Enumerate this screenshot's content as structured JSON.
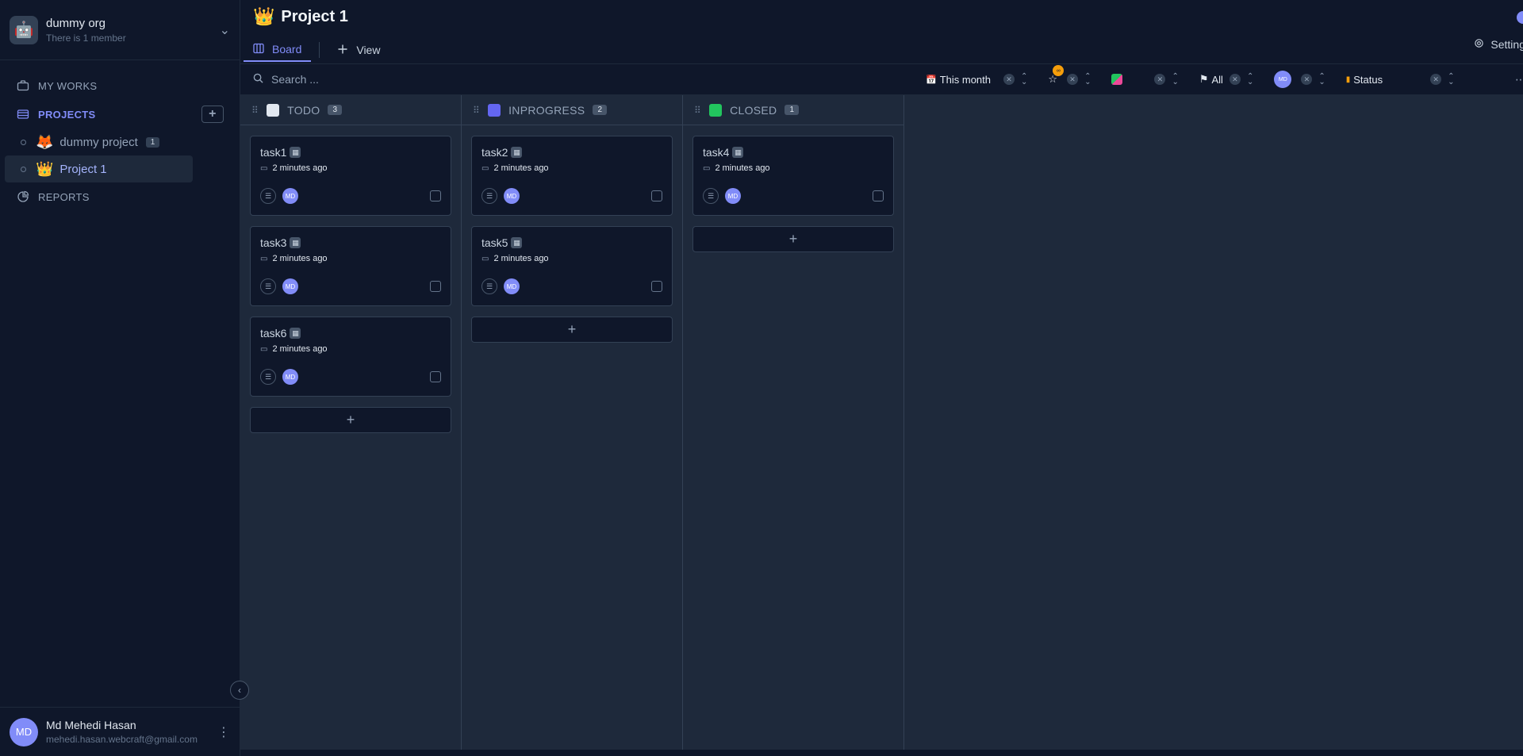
{
  "org": {
    "logo_emoji": "🤖",
    "name": "dummy org",
    "members": "There is 1 member"
  },
  "nav": {
    "my_works": "MY WORKS",
    "projects": "PROJECTS",
    "reports": "REPORTS",
    "add": "+"
  },
  "projects": [
    {
      "emoji": "🦊",
      "name": "dummy project",
      "count": "1"
    },
    {
      "emoji": "👑",
      "name": "Project 1"
    }
  ],
  "user": {
    "initials": "MD",
    "name": "Md Mehedi Hasan",
    "email": "mehedi.hasan.webcraft@gmail.com"
  },
  "header": {
    "emoji": "👑",
    "title": "Project 1",
    "tabs": {
      "board": "Board",
      "view": "View"
    },
    "settings": "Settings"
  },
  "search": {
    "placeholder": "Search ..."
  },
  "filters": {
    "date": "This month",
    "star_badge": "∞",
    "priority": "All",
    "assignee": "MD",
    "status": "Status"
  },
  "columns": [
    {
      "name": "TODO",
      "count": "3",
      "color": "#e2e8f0",
      "cards": [
        {
          "title": "task1",
          "date": "2 minutes ago",
          "assignee": "MD"
        },
        {
          "title": "task3",
          "date": "2 minutes ago",
          "assignee": "MD"
        },
        {
          "title": "task6",
          "date": "2 minutes ago",
          "assignee": "MD"
        }
      ]
    },
    {
      "name": "INPROGRESS",
      "count": "2",
      "color": "#6366f1",
      "cards": [
        {
          "title": "task2",
          "date": "2 minutes ago",
          "assignee": "MD"
        },
        {
          "title": "task5",
          "date": "2 minutes ago",
          "assignee": "MD"
        }
      ]
    },
    {
      "name": "CLOSED",
      "count": "1",
      "color": "#22c55e",
      "cards": [
        {
          "title": "task4",
          "date": "2 minutes ago",
          "assignee": "MD"
        }
      ]
    }
  ],
  "add_card": "+"
}
